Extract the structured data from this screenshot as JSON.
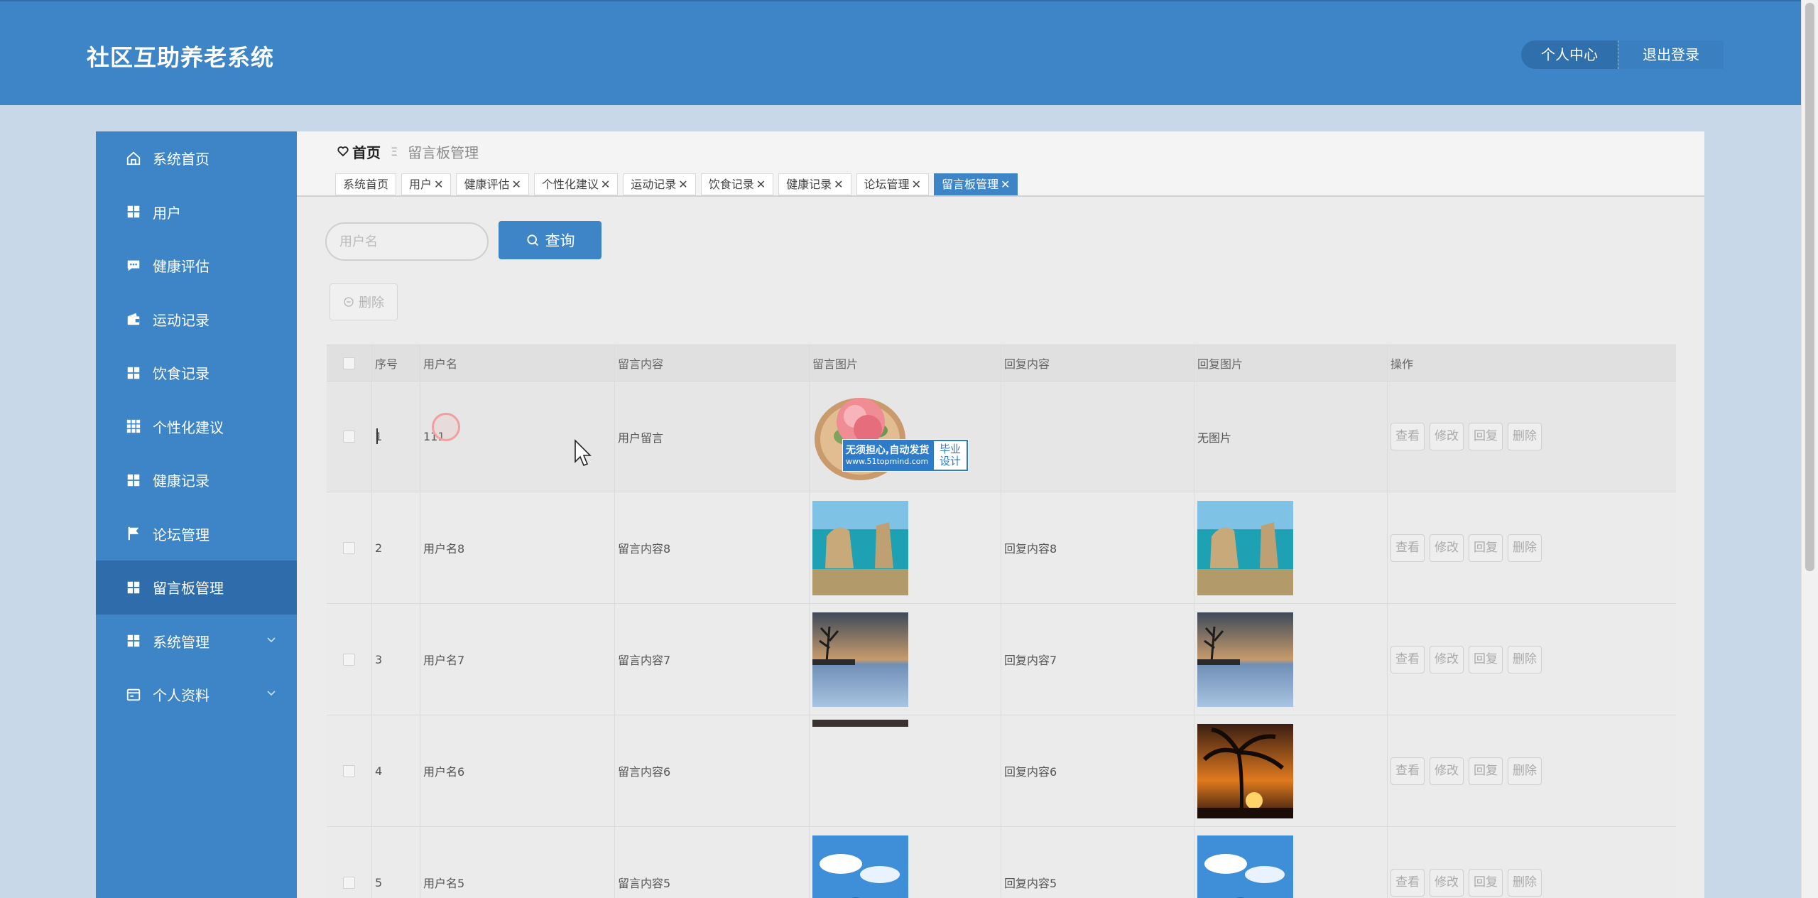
{
  "header": {
    "title": "社区互助养老系统",
    "personal_center": "个人中心",
    "logout": "退出登录",
    "bg_color": "#3d85c6"
  },
  "sidebar": {
    "items": [
      {
        "label": "系统首页",
        "icon": "home-icon"
      },
      {
        "label": "用户",
        "icon": "grid-icon"
      },
      {
        "label": "健康评估",
        "icon": "chat-icon"
      },
      {
        "label": "运动记录",
        "icon": "wallet-icon"
      },
      {
        "label": "饮食记录",
        "icon": "grid-icon"
      },
      {
        "label": "个性化建议",
        "icon": "apps-icon"
      },
      {
        "label": "健康记录",
        "icon": "grid-icon"
      },
      {
        "label": "论坛管理",
        "icon": "flag-icon"
      },
      {
        "label": "留言板管理",
        "icon": "grid-icon",
        "active": true
      },
      {
        "label": "系统管理",
        "icon": "grid-icon",
        "expandable": true
      },
      {
        "label": "个人资料",
        "icon": "card-icon",
        "expandable": true
      }
    ]
  },
  "breadcrumb": {
    "home": "首页",
    "separator": "Ξ",
    "current": "留言板管理"
  },
  "tabs": [
    {
      "label": "系统首页",
      "closable": false
    },
    {
      "label": "用户",
      "closable": true
    },
    {
      "label": "健康评估",
      "closable": true
    },
    {
      "label": "个性化建议",
      "closable": true
    },
    {
      "label": "运动记录",
      "closable": true
    },
    {
      "label": "饮食记录",
      "closable": true
    },
    {
      "label": "健康记录",
      "closable": true
    },
    {
      "label": "论坛管理",
      "closable": true
    },
    {
      "label": "留言板管理",
      "closable": true,
      "active": true
    }
  ],
  "search": {
    "placeholder": "用户名",
    "button_label": "查询"
  },
  "toolbar": {
    "delete_label": "删除"
  },
  "table": {
    "columns": [
      "",
      "序号",
      "用户名",
      "留言内容",
      "留言图片",
      "回复内容",
      "回复图片",
      "操作"
    ],
    "rows": [
      {
        "index": "1",
        "username": "111",
        "content": "用户留言",
        "image": "peach-image",
        "reply": "",
        "reply_image": "",
        "reply_image_text": "无图片"
      },
      {
        "index": "2",
        "username": "用户名8",
        "content": "留言内容8",
        "image": "sea-rocks-image",
        "reply": "回复内容8",
        "reply_image": "sea-rocks-image",
        "reply_image_text": ""
      },
      {
        "index": "3",
        "username": "用户名7",
        "content": "留言内容7",
        "image": "dusk-lake-image",
        "reply": "回复内容7",
        "reply_image": "dusk-lake-image",
        "reply_image_text": ""
      },
      {
        "index": "4",
        "username": "用户名6",
        "content": "留言内容6",
        "image": "broken-image",
        "reply": "回复内容6",
        "reply_image": "palm-sunset-image",
        "reply_image_text": ""
      },
      {
        "index": "5",
        "username": "用户名5",
        "content": "留言内容5",
        "image": "sky-trees-image",
        "reply": "回复内容5",
        "reply_image": "sky-trees-image",
        "reply_image_text": ""
      }
    ],
    "actions": [
      "查看",
      "修改",
      "回复",
      "删除"
    ]
  },
  "promo_badge": {
    "main": "无须担心,自动发货",
    "sub": "www.51topmind.com",
    "tag_line1": "毕业",
    "tag_line2": "设计"
  }
}
